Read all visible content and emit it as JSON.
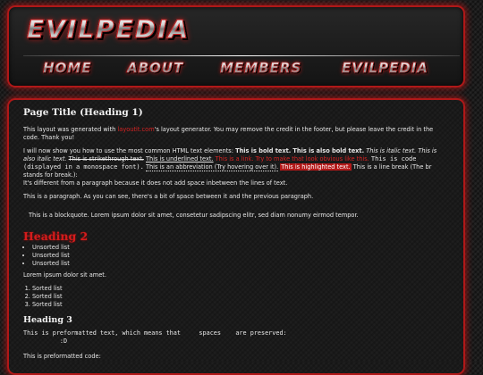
{
  "header": {
    "logo": "EVILPEDIA",
    "nav": [
      "HOME",
      "ABOUT",
      "MEMBERS",
      "EVILPEDIA"
    ]
  },
  "content": {
    "heading1": "Page Title (Heading 1)",
    "intro": {
      "pre": "This layout was generated with ",
      "link": "layoutit.com",
      "post": "'s layout generator. You may remove the credit in the footer, but please leave the credit in the code. Thank you!"
    },
    "elements": {
      "lead": "I will now show you how to use the most common HTML text elements: ",
      "bold1": "This is bold text.",
      "bold2": "This is also bold text.",
      "italic1": "This is italic text.",
      "italic2": "This is also italic text.",
      "strike": "This is strikethrough text.",
      "underline": "This is underlined text.",
      "link": "This is a link. Try to make that look obvious like this.",
      "code": "This is code (displayed in a monospace font).",
      "abbr": "This is an abbreviation (Try hovering over it).",
      "highlight": "This is highlighted text.",
      "linebreak": "This is a line break (The br stands for break.):",
      "after_break": "It's different from a paragraph because it does not add space inbetween the lines of text."
    },
    "paragraph": "This is a paragraph. As you can see, there's a bit of space between it and the previous paragraph.",
    "blockquote": "This is a blockquote. Lorem ipsum dolor sit amet, consetetur sadipscing elitr, sed diam nonumy eirmod tempor.",
    "heading2": "Heading 2",
    "unsorted": [
      "Unsorted list",
      "Unsorted list",
      "Unsorted list"
    ],
    "lorem": "Lorem ipsum dolor sit amet.",
    "sorted": [
      "Sorted list",
      "Sorted list",
      "Sorted list"
    ],
    "heading3": "Heading 3",
    "preformatted": "This is preformatted text, which means that     spaces    are preserved:\n          :D",
    "pre_label": "This is preformatted code:"
  }
}
